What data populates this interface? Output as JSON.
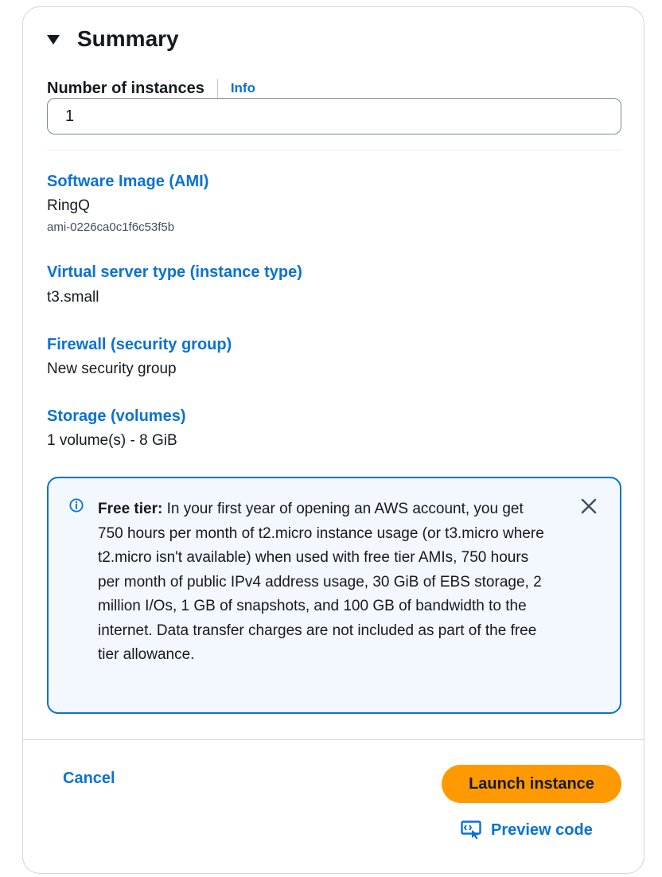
{
  "summary": {
    "title": "Summary",
    "instances": {
      "label": "Number of instances",
      "info_link": "Info",
      "value": "1"
    },
    "ami": {
      "label": "Software Image (AMI)",
      "name": "RingQ",
      "id": "ami-0226ca0c1f6c53f5b"
    },
    "instance_type": {
      "label": "Virtual server type (instance type)",
      "value": "t3.small"
    },
    "firewall": {
      "label": "Firewall (security group)",
      "value": "New security group"
    },
    "storage": {
      "label": "Storage (volumes)",
      "value": "1 volume(s) - 8 GiB"
    },
    "free_tier_alert": {
      "heading": "Free tier:",
      "body": " In your first year of opening an AWS account, you get 750 hours per month of t2.micro instance usage (or t3.micro where t2.micro isn't available) when used with free tier AMIs, 750 hours per month of public IPv4 address usage, 30 GiB of EBS storage, 2 million I/Os, 1 GB of snapshots, and 100 GB of bandwidth to the internet. Data transfer charges are not included as part of the free tier allowance.",
      "icon": "info-icon",
      "dismiss_icon": "close-icon"
    }
  },
  "footer": {
    "cancel_label": "Cancel",
    "launch_label": "Launch instance",
    "preview_label": "Preview code",
    "preview_icon": "preview-code-icon"
  },
  "colors": {
    "link": "#0972d3",
    "primary_button": "#ff9900",
    "alert_background": "#f2f8fd",
    "alert_border": "#0972d3",
    "text": "#16191f"
  }
}
